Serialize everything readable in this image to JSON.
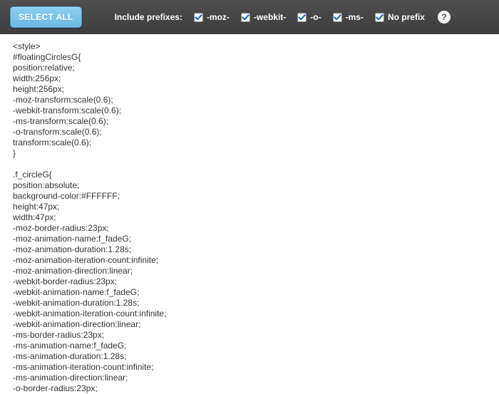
{
  "toolbar": {
    "select_all_label": "SELECT ALL",
    "include_prefixes_label": "Include prefixes:",
    "help_label": "?",
    "checkboxes": [
      {
        "label": "-moz-",
        "checked": true
      },
      {
        "label": "-webkit-",
        "checked": true
      },
      {
        "label": "-o-",
        "checked": true
      },
      {
        "label": "-ms-",
        "checked": true
      },
      {
        "label": "No prefix",
        "checked": true
      }
    ]
  },
  "code": "<style>\n#floatingCirclesG{\nposition:relative;\nwidth:256px;\nheight:256px;\n-moz-transform:scale(0.6);\n-webkit-transform:scale(0.6);\n-ms-transform:scale(0.6);\n-o-transform:scale(0.6);\ntransform:scale(0.6);\n}\n\n.f_circleG{\nposition:absolute;\nbackground-color:#FFFFFF;\nheight:47px;\nwidth:47px;\n-moz-border-radius:23px;\n-moz-animation-name:f_fadeG;\n-moz-animation-duration:1.28s;\n-moz-animation-iteration-count:infinite;\n-moz-animation-direction:linear;\n-webkit-border-radius:23px;\n-webkit-animation-name:f_fadeG;\n-webkit-animation-duration:1.28s;\n-webkit-animation-iteration-count:infinite;\n-webkit-animation-direction:linear;\n-ms-border-radius:23px;\n-ms-animation-name:f_fadeG;\n-ms-animation-duration:1.28s;\n-ms-animation-iteration-count:infinite;\n-ms-animation-direction:linear;\n-o-border-radius:23px;"
}
